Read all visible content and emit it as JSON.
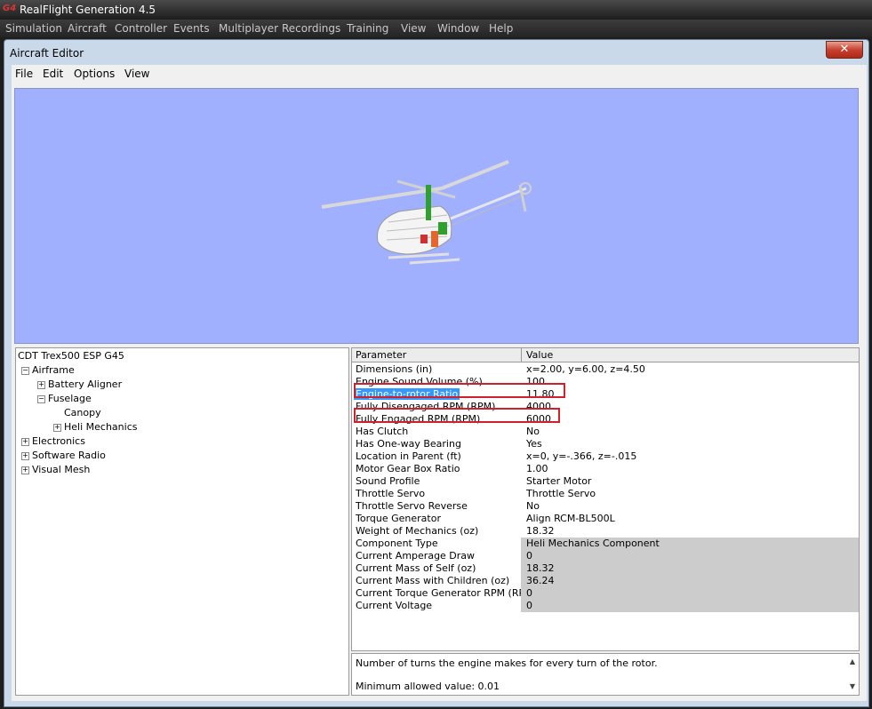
{
  "app": {
    "title": "RealFlight Generation 4.5",
    "logo": "G4",
    "menu": [
      "Simulation",
      "Aircraft",
      "Controller",
      "Events",
      "Multiplayer",
      "Recordings",
      "Training",
      "View",
      "Window",
      "Help"
    ]
  },
  "editor": {
    "title": "Aircraft Editor",
    "close": "✕",
    "menu": [
      "File",
      "Edit",
      "Options",
      "View"
    ]
  },
  "tree": {
    "root": "CDT Trex500 ESP G45",
    "nodes": [
      {
        "label": "Airframe",
        "toggle": "−"
      },
      {
        "label": "Battery Aligner",
        "toggle": "+"
      },
      {
        "label": "Fuselage",
        "toggle": "−"
      },
      {
        "label": "Canopy",
        "toggle": ""
      },
      {
        "label": "Heli Mechanics",
        "toggle": "+"
      },
      {
        "label": "Electronics",
        "toggle": "+"
      },
      {
        "label": "Software Radio",
        "toggle": "+"
      },
      {
        "label": "Visual Mesh",
        "toggle": "+"
      }
    ]
  },
  "grid": {
    "col_parameter": "Parameter",
    "col_value": "Value",
    "rows": [
      {
        "p": "Dimensions (in)",
        "v": "x=2.00, y=6.00, z=4.50"
      },
      {
        "p": "Engine Sound Volume (%)",
        "v": "100"
      },
      {
        "p": "Engine-to-rotor Ratio",
        "v": "11.80"
      },
      {
        "p": "Fully Disengaged RPM (RPM)",
        "v": "4000"
      },
      {
        "p": "Fully Engaged RPM (RPM)",
        "v": "6000"
      },
      {
        "p": "Has Clutch",
        "v": "No"
      },
      {
        "p": "Has One-way Bearing",
        "v": "Yes"
      },
      {
        "p": "Location in Parent (ft)",
        "v": "x=0, y=-.366, z=-.015"
      },
      {
        "p": "Motor Gear Box Ratio",
        "v": "1.00"
      },
      {
        "p": "Sound Profile",
        "v": "Starter Motor"
      },
      {
        "p": "Throttle Servo",
        "v": "Throttle Servo"
      },
      {
        "p": "Throttle Servo Reverse",
        "v": "No"
      },
      {
        "p": "Torque Generator",
        "v": "Align RCM-BL500L"
      },
      {
        "p": "Weight of Mechanics (oz)",
        "v": "18.32"
      },
      {
        "p": "Component Type",
        "v": "Heli Mechanics Component"
      },
      {
        "p": "Current Amperage Draw",
        "v": "0"
      },
      {
        "p": "Current Mass of Self (oz)",
        "v": "18.32"
      },
      {
        "p": "Current Mass with Children (oz)",
        "v": "36.24"
      },
      {
        "p": "Current Torque Generator RPM (RPM)",
        "v": "0"
      },
      {
        "p": "Current Voltage",
        "v": "0"
      }
    ]
  },
  "description": {
    "text": "Number of turns the engine makes for every turn of the rotor.",
    "min": "Minimum allowed value: 0.01",
    "scroll_up": "▲",
    "scroll_down": "▼"
  },
  "colors": {
    "highlight_box": "#d0202c",
    "selection": "#3399ff",
    "viewport_bg": "#a0b0ff"
  }
}
